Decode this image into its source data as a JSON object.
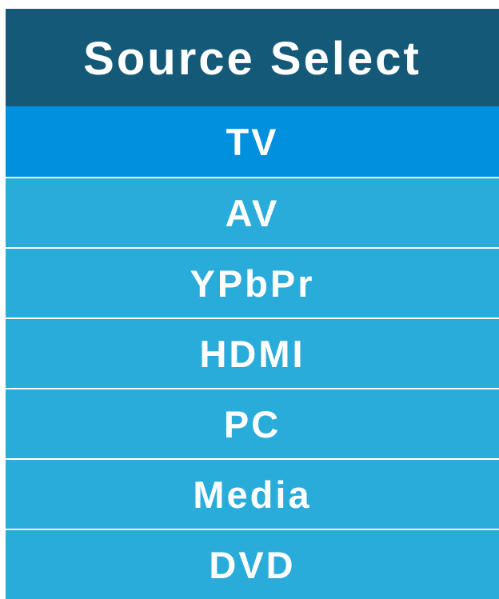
{
  "menu": {
    "title": "Source Select",
    "selected_index": 0,
    "items": [
      {
        "label": "TV"
      },
      {
        "label": "AV"
      },
      {
        "label": "YPbPr"
      },
      {
        "label": "HDMI"
      },
      {
        "label": "PC"
      },
      {
        "label": "Media"
      },
      {
        "label": "DVD"
      }
    ]
  },
  "colors": {
    "header_bg": "#145a78",
    "selected_bg": "#0090de",
    "item_bg": "#2aacdb",
    "text": "#ffffff"
  }
}
